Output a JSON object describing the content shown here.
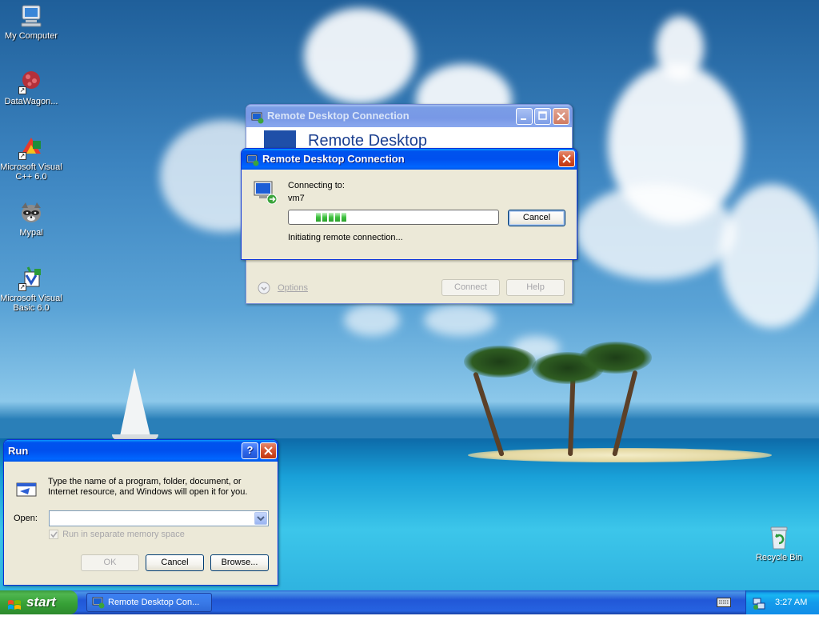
{
  "desktop": {
    "icons": [
      {
        "label": "My Computer"
      },
      {
        "label": "DataWagon..."
      },
      {
        "label": "Microsoft Visual C++ 6.0"
      },
      {
        "label": "Mypal"
      },
      {
        "label": "Microsoft Visual Basic 6.0"
      },
      {
        "label": "Recycle Bin"
      }
    ]
  },
  "rdc_main": {
    "title": "Remote Desktop Connection",
    "banner": "Remote Desktop",
    "options_label": "Options",
    "connect_label": "Connect",
    "help_label": "Help"
  },
  "rdc_dialog": {
    "title": "Remote Desktop Connection",
    "connecting_label": "Connecting to:",
    "host": "vm7",
    "cancel_label": "Cancel",
    "status": "Initiating remote connection..."
  },
  "run_dialog": {
    "title": "Run",
    "help_btn": "?",
    "description": "Type the name of a program, folder, document, or Internet resource, and Windows will open it for you.",
    "open_label": "Open:",
    "open_value": "",
    "checkbox_label": "Run in separate memory space",
    "ok_label": "OK",
    "cancel_label": "Cancel",
    "browse_label": "Browse..."
  },
  "taskbar": {
    "start_label": "start",
    "task_label": "Remote Desktop Con...",
    "clock": "3:27 AM"
  },
  "colors": {
    "title_active": "#0054e3",
    "title_inactive": "#7a9de6",
    "dialog_bg": "#ece9d8",
    "progress": "#3ec23e",
    "start_green": "#37a137",
    "taskbar_blue": "#245edb"
  }
}
